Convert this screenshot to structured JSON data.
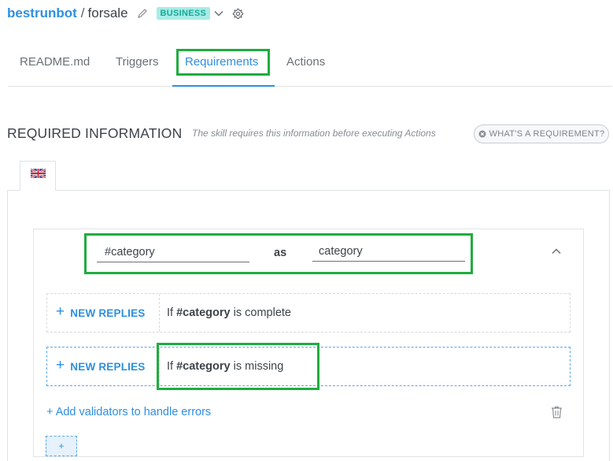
{
  "header": {
    "bot_name": "bestrunbot",
    "separator": "/",
    "skill_name": "forsale",
    "badge": "BUSINESS",
    "icons": [
      "pencil-icon",
      "chevron-down-icon",
      "gear-icon"
    ]
  },
  "tabs": [
    {
      "label": "README.md",
      "active": false
    },
    {
      "label": "Triggers",
      "active": false
    },
    {
      "label": "Requirements",
      "active": true
    },
    {
      "label": "Actions",
      "active": false
    }
  ],
  "section": {
    "title": "REQUIRED INFORMATION",
    "description": "The skill requires this information before executing Actions",
    "help_button": "WHAT'S A REQUIREMENT?"
  },
  "language": {
    "flag": "uk-flag-icon"
  },
  "requirement": {
    "entity": "#category",
    "as_label": "as",
    "variable": "category",
    "replies": [
      {
        "button": "NEW REPLIES",
        "prefix": "If ",
        "entity": "#category",
        "suffix": " is complete"
      },
      {
        "button": "NEW REPLIES",
        "prefix": "If ",
        "entity": "#category",
        "suffix": " is missing"
      }
    ],
    "add_validators": "+ Add validators to handle errors",
    "add_button": "+"
  },
  "colors": {
    "accent": "#2e8fe0",
    "badge_bg": "#a8ece6",
    "badge_text": "#19a89a",
    "highlight": "#1fad3e"
  }
}
